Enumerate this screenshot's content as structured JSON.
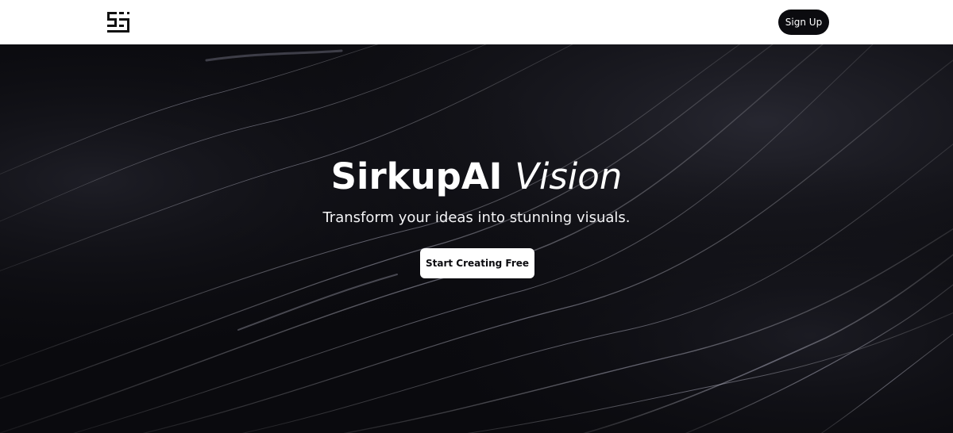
{
  "header": {
    "logo_icon": "sirkupai-logo-icon",
    "signup_label": "Sign Up"
  },
  "hero": {
    "title_brand": "SirkupAI",
    "title_accent": "Vision",
    "subtitle": "Transform your ideas into stunning visuals.",
    "cta_label": "Start Creating Free",
    "background": "dark-abstract-wave-lines"
  },
  "colors": {
    "navbar_bg": "#ffffff",
    "hero_bg": "#0a0a0e",
    "signup_bg": "#0b0b0f",
    "cta_bg": "#ffffff",
    "text_light": "#ffffff"
  }
}
